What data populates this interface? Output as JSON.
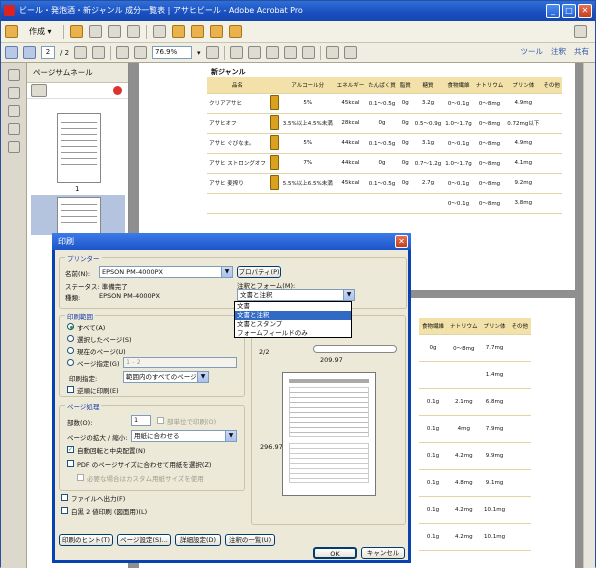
{
  "window": {
    "title": "ビール・発泡酒・新ジャンル 成分一覧表 | アサヒビール - Adobe Acrobat Pro",
    "min": "_",
    "max": "□",
    "close": "✕"
  },
  "toolbar": {
    "create_label": "作成 ▾",
    "page_current": "2",
    "page_total": "/ 2",
    "zoom": "76.9%",
    "zoom_arrow": "▾"
  },
  "links": {
    "tools": "ツール",
    "comment": "注釈",
    "share": "共有"
  },
  "thumbs": {
    "title": "ページサムネール",
    "page1": "1"
  },
  "document": {
    "section": "新ジャンル",
    "headers": [
      "品名",
      "",
      "アルコール分",
      "エネルギー",
      "たんぱく質",
      "脂質",
      "糖質",
      "食物繊維",
      "ナトリウム",
      "プリン体",
      "その他"
    ],
    "rows": [
      [
        "クリアアサヒ",
        "",
        "5%",
        "45kcal",
        "0.1〜0.5g",
        "0g",
        "3.2g",
        "0〜0.1g",
        "0〜8mg",
        "4.9mg",
        ""
      ],
      [
        "アサヒオフ",
        "",
        "3.5%以上4.5%未満",
        "28kcal",
        "0g",
        "0g",
        "0.5〜0.9g",
        "1.0〜1.7g",
        "0〜8mg",
        "0.72mg以下",
        ""
      ],
      [
        "アサヒ ぐびなま。",
        "",
        "5%",
        "44kcal",
        "0.1〜0.5g",
        "0g",
        "3.1g",
        "0〜0.1g",
        "0〜8mg",
        "4.9mg",
        ""
      ],
      [
        "アサヒ ストロングオフ",
        "",
        "7%",
        "44kcal",
        "0g",
        "0g",
        "0.7〜1.2g",
        "1.0〜1.7g",
        "0〜8mg",
        "4.1mg",
        ""
      ],
      [
        "アサヒ 麦搾り",
        "",
        "5.5%以上6.5%未満",
        "45kcal",
        "0.1〜0.5g",
        "0g",
        "2.7g",
        "0〜0.1g",
        "0〜8mg",
        "9.2mg",
        ""
      ],
      [
        "",
        "",
        "",
        "",
        "",
        "",
        "",
        "0〜0.1g",
        "0〜8mg",
        "3.8mg",
        ""
      ]
    ],
    "headers2": [
      "食物繊維",
      "ナトリウム",
      "プリン体",
      "その他"
    ],
    "rows2": [
      [
        "0g",
        "0〜8mg",
        "7.7mg",
        ""
      ],
      [
        "",
        "",
        "1.4mg",
        ""
      ],
      [
        "0.1g",
        "2.1mg",
        "6.8mg",
        ""
      ],
      [
        "0.1g",
        "4mg",
        "7.9mg",
        ""
      ],
      [
        "0.1g",
        "4.2mg",
        "9.9mg",
        ""
      ],
      [
        "0.1g",
        "4.8mg",
        "9.1mg",
        ""
      ],
      [
        "0.1g",
        "4.2mg",
        "10.1mg",
        ""
      ],
      [
        "0.1g",
        "4.2mg",
        "10.1mg",
        ""
      ]
    ]
  },
  "dialog": {
    "title": "印刷",
    "close": "✕",
    "printer_group": "プリンター",
    "name_label": "名前(N):",
    "printer_name": "EPSON PM-4000PX",
    "props_button": "プロパティ(P)",
    "status_label": "ステータス: 準備完了",
    "type_label": "種類:",
    "type_value": "EPSON PM-4000PX",
    "comments_label": "注釈とフォーム(M):",
    "comments_value": "文書と注釈",
    "dropdown_options": [
      "文書",
      "文書と注釈",
      "文書とスタンプ",
      "フォームフィールドのみ"
    ],
    "range_group": "印刷範囲",
    "r_all": "すべて(A)",
    "r_selected": "選択したページ(S)",
    "r_current": "現在のページ(U)",
    "r_pages": "ページ指定(G)",
    "pages_value": "1 - 2",
    "subset_label": "印刷指定:",
    "subset_value": "範囲内のすべてのページ",
    "reverse": "逆順に印刷(E)",
    "handling_group": "ページ処理",
    "copies_label": "部数(O):",
    "copies_value": "1",
    "collate": "部単位で印刷(O)",
    "scale_label": "ページの拡大 / 縮小:",
    "scale_value": "用紙に合わせる",
    "autorotate": "自動回転と中央配置(N)",
    "pdfsize": "PDF のページサイズに合わせて用紙を選択(Z)",
    "custom_paper": "必要な場合はカスタム用紙サイズを使用",
    "file_out": "ファイルへ出力(F)",
    "grayscale": "白黒 2 値印刷 (図面用)(L)",
    "preview_frac": "2/2",
    "dim_w": "209.97",
    "dim_h": "296.97",
    "btn_tips": "印刷のヒント(T)",
    "btn_page_setup": "ページ設定(S)...",
    "btn_advanced": "詳細設定(D)",
    "btn_summary": "注釈の一覧(U)",
    "btn_ok": "OK",
    "btn_cancel": "キャンセル"
  }
}
